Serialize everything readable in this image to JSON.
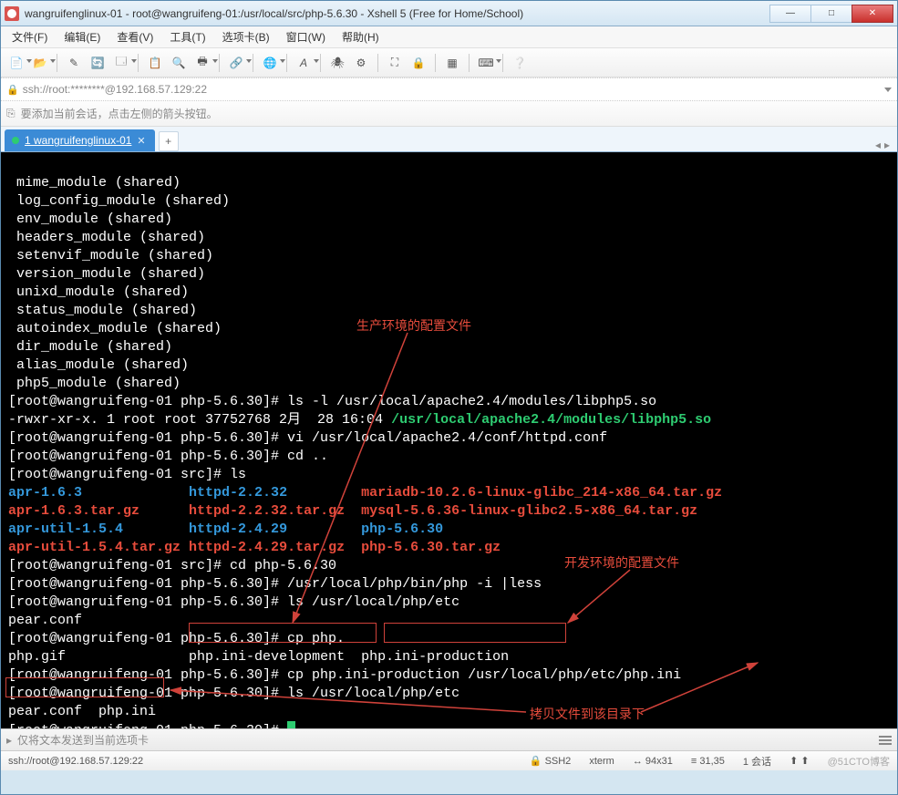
{
  "window": {
    "title": "wangruifenglinux-01 - root@wangruifeng-01:/usr/local/src/php-5.6.30 - Xshell 5 (Free for Home/School)"
  },
  "menu": {
    "items": [
      "文件(F)",
      "编辑(E)",
      "查看(V)",
      "工具(T)",
      "选项卡(B)",
      "窗口(W)",
      "帮助(H)"
    ]
  },
  "toolbar_icons": [
    "new",
    "open",
    "|",
    "wand",
    "reload",
    "props",
    "|",
    "copy",
    "search",
    "print",
    "|",
    "link",
    "|",
    "globe",
    "|",
    "font",
    "|",
    "bug",
    "|",
    "fit",
    "lock",
    "|",
    "grid",
    "|",
    "kbd",
    "|",
    "help"
  ],
  "addr": {
    "text": "ssh://root:********@192.168.57.129:22"
  },
  "hint": {
    "text": "要添加当前会话，点击左侧的箭头按钮。"
  },
  "tab": {
    "label": "1 wangruifenglinux-01"
  },
  "term": {
    "l01": " mime_module (shared)",
    "l02": " log_config_module (shared)",
    "l03": " env_module (shared)",
    "l04": " headers_module (shared)",
    "l05": " setenvif_module (shared)",
    "l06": " version_module (shared)",
    "l07": " unixd_module (shared)",
    "l08": " status_module (shared)",
    "l09": " autoindex_module (shared)",
    "l10": " dir_module (shared)",
    "l11": " alias_module (shared)",
    "l12": " php5_module (shared)",
    "p1a": "[root@wangruifeng-01 php-5.6.30]# ls -l /usr/local/apache2.4/modules/libphp5.so",
    "p1b": "-rwxr-xr-x. 1 root root 37752768 2月  28 16:04 ",
    "p1c": "/usr/local/apache2.4/modules/libphp5.so",
    "p2": "[root@wangruifeng-01 php-5.6.30]# vi /usr/local/apache2.4/conf/httpd.conf",
    "p3": "[root@wangruifeng-01 php-5.6.30]# cd ..",
    "p4": "[root@wangruifeng-01 src]# ls",
    "f_a1": "apr-1.6.3",
    "f_b1": "httpd-2.2.32",
    "f_c1": "mariadb-10.2.6-linux-glibc_214-x86_64.tar.gz",
    "f_a2": "apr-1.6.3.tar.gz",
    "f_b2": "httpd-2.2.32.tar.gz",
    "f_c2": "mysql-5.6.36-linux-glibc2.5-x86_64.tar.gz",
    "f_a3": "apr-util-1.5.4",
    "f_b3": "httpd-2.4.29",
    "f_c3": "php-5.6.30",
    "f_a4": "apr-util-1.5.4.tar.gz",
    "f_b4": "httpd-2.4.29.tar.gz",
    "f_c4": "php-5.6.30.tar.gz",
    "p5": "[root@wangruifeng-01 src]# cd php-5.6.30",
    "p6": "[root@wangruifeng-01 php-5.6.30]# /usr/local/php/bin/php -i |less",
    "p7": "[root@wangruifeng-01 php-5.6.30]# ls /usr/local/php/etc",
    "p7o": "pear.conf",
    "p8": "[root@wangruifeng-01 php-5.6.30]# cp php.",
    "p8a": "php.gif              ",
    "p8b": "php.ini-development",
    "p8c": "php.ini-production",
    "p9": "[root@wangruifeng-01 php-5.6.30]# cp php.ini-production /usr/local/php/etc/php.ini",
    "p10": "[root@wangruifeng-01 php-5.6.30]# ls /usr/local/php/etc",
    "p10o": "pear.conf  php.ini",
    "p11": "[root@wangruifeng-01 php-5.6.30]# "
  },
  "anno": {
    "a1": "生产环境的配置文件",
    "a2": "开发环境的配置文件",
    "a3": "拷贝文件到该目录下"
  },
  "sendbar": {
    "text": "仅将文本发送到当前选项卡"
  },
  "status": {
    "left": "ssh://root@192.168.57.129:22",
    "s1": "SSH2",
    "s2": "xterm",
    "s3": "94x31",
    "s4": "31,35",
    "s5": "1 会话",
    "wm": "@51CTO博客"
  }
}
